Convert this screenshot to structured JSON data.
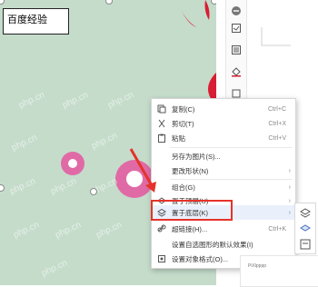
{
  "slide": {
    "textbox_label": "百度经验",
    "watermarks": [
      "php.cn",
      "php.cn",
      "php.cn",
      "php.cn",
      "php.cn",
      "php.cn",
      "php.cn",
      "php.cn",
      "php.cn",
      "php.cn",
      "php.cn",
      "php.cn"
    ]
  },
  "context_menu": {
    "items": [
      {
        "icon": "copy-icon",
        "label": "复制(C)",
        "shortcut": "Ctrl+C"
      },
      {
        "icon": "cut-icon",
        "label": "剪切(T)",
        "shortcut": "Ctrl+X"
      },
      {
        "icon": "paste-icon",
        "label": "粘贴",
        "shortcut": "Ctrl+V"
      },
      {
        "icon": "",
        "label": "另存为图片(S)...",
        "shortcut": ""
      },
      {
        "icon": "",
        "label": "更改形状(N)",
        "shortcut": ""
      },
      {
        "icon": "",
        "label": "组合(G)",
        "shortcut": ""
      },
      {
        "icon": "bring-front-icon",
        "label": "置于顶层(U)",
        "shortcut": ""
      },
      {
        "icon": "send-back-icon",
        "label": "置于底层(K)",
        "shortcut": ""
      },
      {
        "icon": "hyperlink-icon",
        "label": "超链接(H)...",
        "shortcut": "Ctrl+K"
      },
      {
        "icon": "",
        "label": "设置自选图形的默认效果(I)",
        "shortcut": ""
      },
      {
        "icon": "format-object-icon",
        "label": "设置对象格式(O)...",
        "shortcut": ""
      }
    ]
  },
  "bottom_panel": {
    "text": "PiXlpppp"
  },
  "colors": {
    "slide_bg": "#c5dccb",
    "ring_pink": "#e06aa6",
    "accent_red": "#d81e34",
    "highlight": "#e5332a"
  }
}
